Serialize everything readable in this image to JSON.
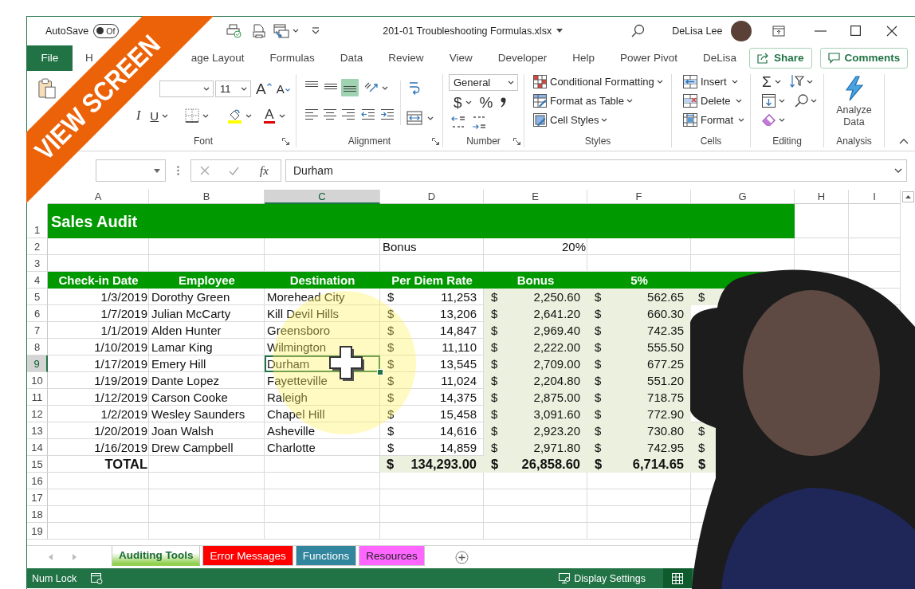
{
  "banner": {
    "text": "VIEW SCREEN"
  },
  "title_bar": {
    "autosave_label": "AutoSave",
    "autosave": {
      "label": "Of",
      "on": false
    },
    "filename": "201-01 Troubleshooting Formulas.xlsx",
    "user_name": "DeLisa Lee"
  },
  "ribbon_tabs": [
    {
      "label": "File",
      "kind": "file"
    },
    {
      "label": "H",
      "kind": "tab"
    },
    {
      "label": "age Layout",
      "kind": "tab"
    },
    {
      "label": "Formulas",
      "kind": "tab"
    },
    {
      "label": "Data",
      "kind": "tab"
    },
    {
      "label": "Review",
      "kind": "tab"
    },
    {
      "label": "View",
      "kind": "tab"
    },
    {
      "label": "Developer",
      "kind": "tab"
    },
    {
      "label": "Help",
      "kind": "tab"
    },
    {
      "label": "Power Pivot",
      "kind": "tab"
    },
    {
      "label": "DeLisa",
      "kind": "tab"
    }
  ],
  "share_button": "Share",
  "comments_button": "Comments",
  "font_group": {
    "size": "11",
    "grow_glyph": "A",
    "shrink_glyph": "A",
    "italic_glyph": "I",
    "underline_glyph": "U",
    "font_color_glyph": "A",
    "label": "Font"
  },
  "alignment_group": {
    "vertical": [
      {
        "kind": "top",
        "selected": false
      },
      {
        "kind": "middle",
        "selected": false
      },
      {
        "kind": "bottom",
        "selected": true
      }
    ],
    "label": "Alignment"
  },
  "number_group": {
    "format": "General",
    "currency_glyph": "$",
    "percent_glyph": "%",
    "label": "Number"
  },
  "styles_group": {
    "items": [
      {
        "label": "Conditional Formatting",
        "kind": "conditional"
      },
      {
        "label": "Format as Table",
        "kind": "table"
      },
      {
        "label": "Cell Styles",
        "kind": "cell_styles"
      }
    ],
    "label": "Styles"
  },
  "cells_group": {
    "items": [
      {
        "label": "Insert",
        "kind": "insert"
      },
      {
        "label": "Delete",
        "kind": "delete"
      },
      {
        "label": "Format",
        "kind": "format"
      }
    ],
    "label": "Cells"
  },
  "editing_group": {
    "sum_glyph": "Σ",
    "label": "Editing"
  },
  "analysis_group": {
    "button": "Analyze Data",
    "label": "Analysis"
  },
  "formula_bar": {
    "function_glyph": "fx",
    "value": "Durham"
  },
  "columns": [
    {
      "label": "A",
      "selected": false
    },
    {
      "label": "B",
      "selected": false
    },
    {
      "label": "C",
      "selected": true
    },
    {
      "label": "D",
      "selected": false
    },
    {
      "label": "E",
      "selected": false
    },
    {
      "label": "F",
      "selected": false
    },
    {
      "label": "G",
      "selected": false
    },
    {
      "label": "H",
      "selected": false
    },
    {
      "label": "I",
      "selected": false
    }
  ],
  "row_headers": [
    {
      "label": "1",
      "selected": false
    },
    {
      "label": "2",
      "selected": false
    },
    {
      "label": "3",
      "selected": false
    },
    {
      "label": "4",
      "selected": false
    },
    {
      "label": "5",
      "selected": false
    },
    {
      "label": "6",
      "selected": false
    },
    {
      "label": "7",
      "selected": false
    },
    {
      "label": "8",
      "selected": false
    },
    {
      "label": "9",
      "selected": true
    },
    {
      "label": "10",
      "selected": false
    },
    {
      "label": "11",
      "selected": false
    },
    {
      "label": "12",
      "selected": false
    },
    {
      "label": "13",
      "selected": false
    },
    {
      "label": "14",
      "selected": false
    },
    {
      "label": "15",
      "selected": false
    },
    {
      "label": "16",
      "selected": false
    },
    {
      "label": "17",
      "selected": false
    },
    {
      "label": "18",
      "selected": false
    },
    {
      "label": "19",
      "selected": false
    }
  ],
  "sheet": {
    "title": "Sales Audit",
    "bonus_label": "Bonus",
    "bonus_rate": "20%",
    "headers": [
      "Check-in Date",
      "Employee",
      "Destination",
      "Per Diem Rate",
      "Bonus",
      "5%"
    ],
    "records": [
      {
        "date": "1/3/2019",
        "employee": "Dorothy Green",
        "destination": "Morehead City",
        "per_diem_rate": [
          "$",
          "11,253"
        ],
        "bonus": [
          "$",
          "2,250.60"
        ],
        "five_percent": [
          "$",
          "562.65"
        ],
        "column_7": "$"
      },
      {
        "date": "1/7/2019",
        "employee": "Julian McCarty",
        "destination": "Kill Devil Hills",
        "per_diem_rate": [
          "$",
          "13,206"
        ],
        "bonus": [
          "$",
          "2,641.20"
        ],
        "five_percent": [
          "$",
          "660.30"
        ]
      },
      {
        "date": "1/1/2019",
        "employee": "Alden Hunter",
        "destination": "Greensboro",
        "per_diem_rate": [
          "$",
          "14,847"
        ],
        "bonus": [
          "$",
          "2,969.40"
        ],
        "five_percent": [
          "$",
          "742.35"
        ]
      },
      {
        "date": "1/10/2019",
        "employee": "Lamar King",
        "destination": "Wilmington",
        "per_diem_rate": [
          "$",
          "11,110"
        ],
        "bonus": [
          "$",
          "2,222.00"
        ],
        "five_percent": [
          "$",
          "555.50"
        ]
      },
      {
        "date": "1/17/2019",
        "employee": "Emery Hill",
        "destination": "Durham",
        "per_diem_rate": [
          "$",
          "13,545"
        ],
        "bonus": [
          "$",
          "2,709.00"
        ],
        "five_percent": [
          "$",
          "677.25"
        ]
      },
      {
        "date": "1/19/2019",
        "employee": "Dante Lopez",
        "destination": "Fayetteville",
        "per_diem_rate": [
          "$",
          "11,024"
        ],
        "bonus": [
          "$",
          "2,204.80"
        ],
        "five_percent": [
          "$",
          "551.20"
        ]
      },
      {
        "date": "1/12/2019",
        "employee": "Carson Cooke",
        "destination": "Raleigh",
        "per_diem_rate": [
          "$",
          "14,375"
        ],
        "bonus": [
          "$",
          "2,875.00"
        ],
        "five_percent": [
          "$",
          "718.75"
        ]
      },
      {
        "date": "1/2/2019",
        "employee": "Wesley Saunders",
        "destination": "Chapel Hill",
        "per_diem_rate": [
          "$",
          "15,458"
        ],
        "bonus": [
          "$",
          "3,091.60"
        ],
        "five_percent": [
          "$",
          "772.90"
        ]
      },
      {
        "date": "1/20/2019",
        "employee": "Joan Walsh",
        "destination": "Asheville",
        "per_diem_rate": [
          "$",
          "14,616"
        ],
        "bonus": [
          "$",
          "2,923.20"
        ],
        "five_percent": [
          "$",
          "730.80"
        ],
        "column_7": "$"
      },
      {
        "date": "1/16/2019",
        "employee": "Drew Campbell",
        "destination": "Charlotte",
        "per_diem_rate": [
          "$",
          "14,859"
        ],
        "bonus": [
          "$",
          "2,971.80"
        ],
        "five_percent": [
          "$",
          "742.95"
        ],
        "column_7": "$"
      }
    ],
    "total": {
      "label": "TOTAL",
      "per_diem_rate": [
        "$",
        "134,293.00"
      ],
      "bonus": [
        "$",
        "26,858.60"
      ],
      "five_percent": [
        "$",
        "6,714.65"
      ],
      "column_7": "$"
    }
  },
  "sheet_tabs": [
    {
      "label": "Auditing Tools",
      "selected": true,
      "color": "#92d050"
    },
    {
      "label": "Error Messages",
      "selected": false,
      "color": "#ff0000"
    },
    {
      "label": "Functions",
      "selected": false,
      "color": "#31859c"
    },
    {
      "label": "Resources",
      "selected": false,
      "color": "#ff66ff"
    }
  ],
  "status_bar": {
    "num_lock": "Num Lock",
    "display_settings": "Display Settings",
    "views": [
      {
        "kind": "normal",
        "selected": true
      }
    ]
  }
}
